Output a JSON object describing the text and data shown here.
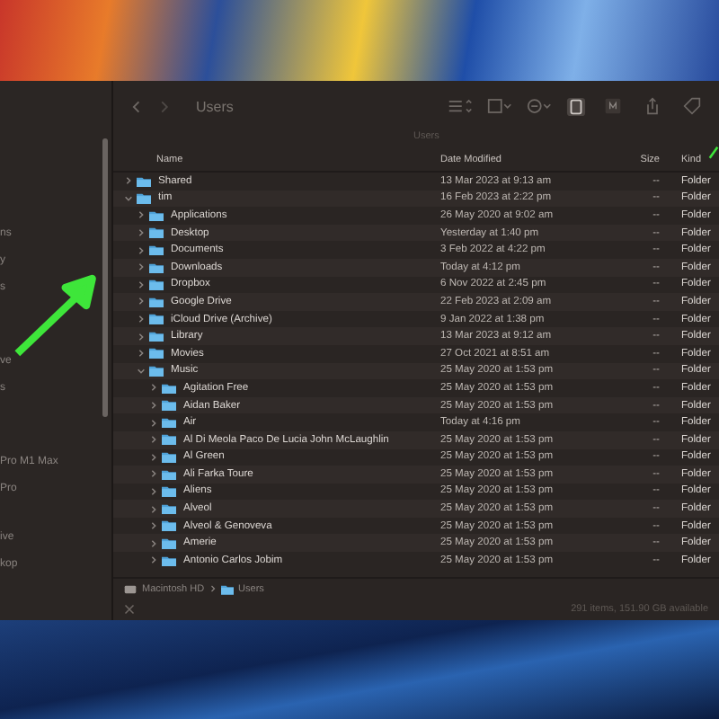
{
  "sidebar": {
    "items": [
      {
        "label": "ns"
      },
      {
        "label": "y"
      },
      {
        "label": "s"
      },
      {
        "label": "ve"
      },
      {
        "label": "s"
      },
      {
        "label": "Pro M1 Max"
      },
      {
        "label": "Pro"
      },
      {
        "label": "ive"
      },
      {
        "label": "kop"
      }
    ]
  },
  "toolbar": {
    "title": "Users",
    "path_label": "Users"
  },
  "table": {
    "columns": [
      "Name",
      "Date Modified",
      "Size",
      "Kind"
    ],
    "rows": [
      {
        "name": "Shared",
        "date": "13 Mar 2023 at 9:13 am",
        "size": "--",
        "kind": "Folder",
        "expanded": false
      },
      {
        "name": "tim",
        "date": "16 Feb 2023 at 2:22 pm",
        "size": "--",
        "kind": "Folder",
        "expanded": true,
        "children": [
          {
            "name": "Applications",
            "date": "26 May 2020 at 9:02 am",
            "size": "--",
            "kind": "Folder",
            "expanded": false
          },
          {
            "name": "Desktop",
            "date": "Yesterday at 1:40 pm",
            "size": "--",
            "kind": "Folder",
            "expanded": false
          },
          {
            "name": "Documents",
            "date": "3 Feb 2022 at 4:22 pm",
            "size": "--",
            "kind": "Folder",
            "expanded": false
          },
          {
            "name": "Downloads",
            "date": "Today at 4:12 pm",
            "size": "--",
            "kind": "Folder",
            "expanded": false
          },
          {
            "name": "Dropbox",
            "date": "6 Nov 2022 at 2:45 pm",
            "size": "--",
            "kind": "Folder",
            "expanded": false
          },
          {
            "name": "Google Drive",
            "date": "22 Feb 2023 at 2:09 am",
            "size": "--",
            "kind": "Folder",
            "expanded": false
          },
          {
            "name": "iCloud Drive (Archive)",
            "date": "9 Jan 2022 at 1:38 pm",
            "size": "--",
            "kind": "Folder",
            "expanded": false
          },
          {
            "name": "Library",
            "date": "13 Mar 2023 at 9:12 am",
            "size": "--",
            "kind": "Folder",
            "expanded": false
          },
          {
            "name": "Movies",
            "date": "27 Oct 2021 at 8:51 am",
            "size": "--",
            "kind": "Folder",
            "expanded": false
          },
          {
            "name": "Music",
            "date": "25 May 2020 at 1:53 pm",
            "size": "--",
            "kind": "Folder",
            "expanded": true,
            "children": [
              {
                "name": "Agitation Free",
                "date": "25 May 2020 at 1:53 pm",
                "size": "--",
                "kind": "Folder",
                "expanded": false
              },
              {
                "name": "Aidan Baker",
                "date": "25 May 2020 at 1:53 pm",
                "size": "--",
                "kind": "Folder",
                "expanded": false
              },
              {
                "name": "Air",
                "date": "Today at 4:16 pm",
                "size": "--",
                "kind": "Folder",
                "expanded": false
              },
              {
                "name": "Al Di Meola Paco De Lucia John McLaughlin",
                "date": "25 May 2020 at 1:53 pm",
                "size": "--",
                "kind": "Folder",
                "expanded": false
              },
              {
                "name": "Al Green",
                "date": "25 May 2020 at 1:53 pm",
                "size": "--",
                "kind": "Folder",
                "expanded": false
              },
              {
                "name": "Ali Farka Toure",
                "date": "25 May 2020 at 1:53 pm",
                "size": "--",
                "kind": "Folder",
                "expanded": false
              },
              {
                "name": "Aliens",
                "date": "25 May 2020 at 1:53 pm",
                "size": "--",
                "kind": "Folder",
                "expanded": false
              },
              {
                "name": "Alveol",
                "date": "25 May 2020 at 1:53 pm",
                "size": "--",
                "kind": "Folder",
                "expanded": false
              },
              {
                "name": "Alveol & Genoveva",
                "date": "25 May 2020 at 1:53 pm",
                "size": "--",
                "kind": "Folder",
                "expanded": false
              },
              {
                "name": "Amerie",
                "date": "25 May 2020 at 1:53 pm",
                "size": "--",
                "kind": "Folder",
                "expanded": false
              },
              {
                "name": "Antonio Carlos Jobim",
                "date": "25 May 2020 at 1:53 pm",
                "size": "--",
                "kind": "Folder",
                "expanded": false
              }
            ]
          }
        ]
      }
    ]
  },
  "path_bar": [
    "Macintosh HD",
    "Users"
  ],
  "status_bar": "291 items, 151.90 GB available"
}
